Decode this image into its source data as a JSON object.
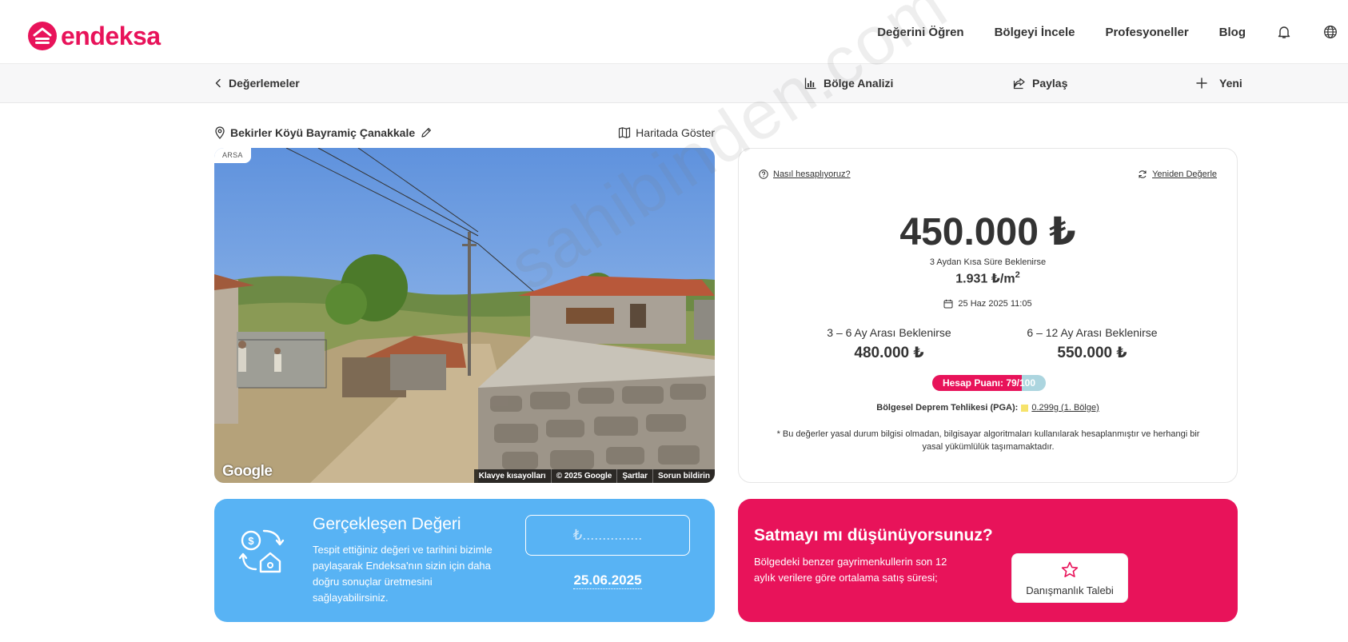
{
  "brand": {
    "name": "endeksa",
    "color": "#e8135a"
  },
  "nav": {
    "items": [
      "Değerini Öğren",
      "Bölgeyi İncele",
      "Profesyoneller",
      "Blog"
    ],
    "icons": [
      "bell-icon",
      "globe-icon"
    ]
  },
  "subbar": {
    "back_label": "Değerlemeler",
    "region_analysis": "Bölge Analizi",
    "share": "Paylaş",
    "new": "Yeni"
  },
  "property": {
    "address": "Bekirler Köyü Bayramiç Çanakkale",
    "show_on_map": "Haritada Göster",
    "tag": "ARSA"
  },
  "map_attribution": {
    "google": "Google",
    "items": [
      "Klavye kısayolları",
      "© 2025 Google",
      "Şartlar",
      "Sorun bildirin"
    ]
  },
  "valuation": {
    "how_calculated": "Nasıl hesaplıyoruz?",
    "revalue": "Yeniden Değerle",
    "price": "450.000 ₺",
    "price_note": "3 Aydan Kısa Süre Beklenirse",
    "per_m2": "1.931 ₺/m",
    "per_m2_sup": "2",
    "date": "25 Haz 2025 11:05",
    "ranges": [
      {
        "label": "3 – 6 Ay Arası Beklenirse",
        "value": "480.000 ₺"
      },
      {
        "label": "6 – 12 Ay Arası Beklenirse",
        "value": "550.000 ₺"
      }
    ],
    "score_label": "Hesap Puanı: 79/100",
    "score_fraction": 0.79,
    "quake_label": "Bölgesel Deprem Tehlikesi (PGA):",
    "quake_value": "0.299g (1. Bölge)",
    "quake_color": "#f6e36b",
    "disclaimer": "* Bu değerler yasal durum bilgisi olmadan, bilgisayar algoritmaları kullanılarak hesaplanmıştır ve herhangi bir yasal yükümlülük taşımamaktadır."
  },
  "realized": {
    "title": "Gerçekleşen Değeri",
    "text": "Tespit ettiğiniz değeri ve tarihini bizimle paylaşarak Endeksa'nın sizin için daha doğru sonuçlar üretmesini sağlayabilirsiniz.",
    "price_placeholder": "₺...............",
    "date": "25.06.2025",
    "color": "#58b3f4"
  },
  "sell": {
    "title": "Satmayı mı düşünüyorsunuz?",
    "text": "Bölgedeki benzer gayrimenkullerin son 12 aylık verilere göre ortalama satış süresi;",
    "button": "Danışmanlık Talebi"
  },
  "watermark": "sahibinden.com"
}
